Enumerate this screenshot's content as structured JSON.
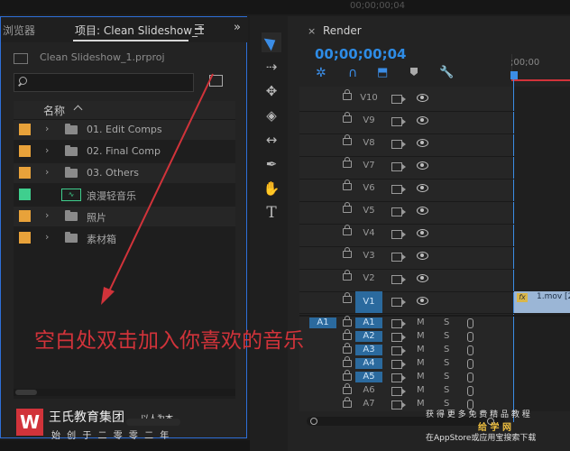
{
  "top_ghost_timecode": "00;00;00;04",
  "project_panel": {
    "tabs": [
      {
        "label": "浏览器"
      },
      {
        "label": "项目: Clean Slideshow_1"
      }
    ],
    "menu_icon": "hamburger-icon",
    "expand_icon": "double-chevron-right-icon",
    "file_name": "Clean Slideshow_1.prproj",
    "search_placeholder": "",
    "column_header": "名称",
    "items": [
      {
        "label": "01. Edit Comps",
        "color": "#e8a23a",
        "type": "bin",
        "expandable": true
      },
      {
        "label": "02. Final Comp",
        "color": "#e8a23a",
        "type": "bin",
        "expandable": true
      },
      {
        "label": "03. Others",
        "color": "#e8a23a",
        "type": "bin",
        "expandable": true
      },
      {
        "label": "浪漫轻音乐",
        "color": "#3fcf8e",
        "type": "audio",
        "expandable": false
      },
      {
        "label": "照片",
        "color": "#e8a23a",
        "type": "bin",
        "expandable": true
      },
      {
        "label": "素材箱",
        "color": "#e8a23a",
        "type": "bin",
        "expandable": true
      }
    ]
  },
  "overlay_text": "空白处双击加入你喜欢的音乐",
  "timeline": {
    "tab_label": "Render",
    "timecode": "00;00;00;04",
    "ruler_label": ";00;00",
    "accent_color": "#2e8ce6",
    "clip_label": "1.mov [2",
    "clip_fx": "fx",
    "video_tracks": [
      "V10",
      "V9",
      "V8",
      "V7",
      "V6",
      "V5",
      "V4",
      "V3",
      "V2",
      "V1"
    ],
    "audio_tracks": [
      "A1",
      "A2",
      "A3",
      "A4",
      "A5",
      "A6",
      "A7"
    ],
    "source_patch_audio": "A1",
    "mute_label": "M",
    "solo_label": "S"
  },
  "watermark": {
    "brand": "王氏教育集团",
    "tagline": "以人为本",
    "subtitle": "始 创 于 二 零 零 二 年",
    "right_line1": "获 得 更 多 免 费 精 品 教 程",
    "right_line2": "给 学 网",
    "right_line3": "在AppStore或应用宝搜索下载"
  }
}
